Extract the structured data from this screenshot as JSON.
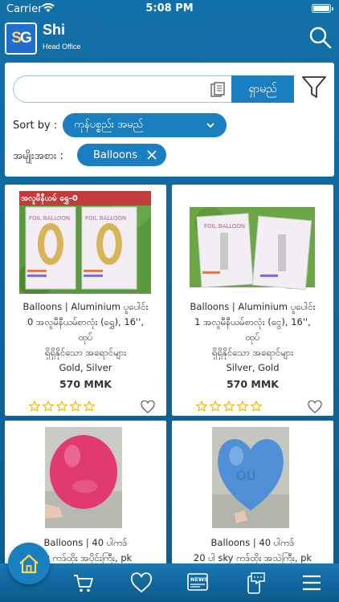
{
  "status_bar": {
    "carrier": "Carrier",
    "time": "5:08 PM"
  },
  "header": {
    "logo_text_1": "S",
    "logo_text_2": "G",
    "title": "Shi",
    "subtitle": "Head Office"
  },
  "filters": {
    "search_placeholder": "",
    "search_button": "ရှာမည်",
    "sort_label": "Sort by :",
    "sort_value": "ကုန်ပစ္စည်း အမည်",
    "category_label": "အမျိုးအစား :",
    "category_chip": "Balloons"
  },
  "products": [
    {
      "name_line1": "Balloons | Aluminium ပူပေါင်း",
      "name_line2": "0 အလူမီနီယမ်စာလုံး (ရွှေ), 16'',",
      "name_line3": "ထုပ်",
      "name_line4": "ရှိရှိနိုင်သော အရောင်များ",
      "name_line5": "Gold, Silver",
      "price": "570 MMK",
      "banner": "အလူမီနီယမ် ရွှေ-0",
      "rating": 0
    },
    {
      "name_line1": "Balloons | Aluminium ပူပေါင်း",
      "name_line2": "1 အလူမီနီယမ်စာလုံး (ငွေ), 16'',",
      "name_line3": "ထုပ်",
      "name_line4": "ရှိရှိနိုင်သော အရောင်များ",
      "name_line5": "Silver, Gold",
      "price": "570 MMK",
      "rating": 0
    },
    {
      "name_line1": "Balloons | 40 ပါကဒ်",
      "name_line2": "ky ကဒ်ထိုး အပိုင်းကြီး, pk"
    },
    {
      "name_line1": "Balloons | 40 ပါကဒ်",
      "name_line2": "20 ပါ sky ကဒ်ထိုး အသဲကြီး, pk"
    }
  ],
  "colors": {
    "primary": "#1a7fc0",
    "header_bg": "#1270a8",
    "star": "#e6b800"
  },
  "icons": [
    "wifi-icon",
    "search-icon",
    "clipboard-icon",
    "filter-icon",
    "chevron-down-icon",
    "close-icon",
    "star-icon",
    "heart-icon",
    "home-icon",
    "cart-icon",
    "favorite-icon",
    "news-icon",
    "chat-icon",
    "menu-icon"
  ]
}
